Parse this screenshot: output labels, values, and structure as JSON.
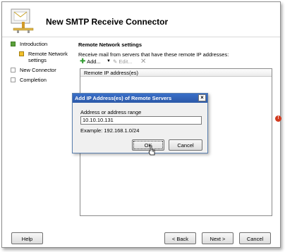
{
  "window": {
    "title": "New SMTP Receive Connector"
  },
  "nav": {
    "items": [
      {
        "label": "Introduction",
        "state": "done"
      },
      {
        "label": "Remote Network settings",
        "state": "current"
      },
      {
        "label": "New Connector",
        "state": "pending"
      },
      {
        "label": "Completion",
        "state": "pending"
      }
    ]
  },
  "main": {
    "section_title": "Remote Network settings",
    "description": "Receive mail from servers that have these remote IP addresses:",
    "toolbar": {
      "add_label": "Add...",
      "edit_label": "Edit...",
      "delete_icon": "delete-icon"
    },
    "list": {
      "column_header": "Remote IP address(es)",
      "rows": []
    }
  },
  "dialog": {
    "title": "Add IP Address(es) of Remote Servers",
    "close_glyph": "×",
    "field_label": "Address or address range",
    "field_value": "10.10.10.131",
    "example": "Example: 192.168.1.0/24",
    "ok_label": "OK",
    "cancel_label": "Cancel"
  },
  "footer": {
    "help_label": "Help",
    "back_label": "< Back",
    "next_label": "Next >",
    "cancel_label": "Cancel"
  },
  "status": {
    "error_glyph": "!"
  },
  "colors": {
    "nav_done": "#5aa03a",
    "nav_current": "#f2c12e",
    "dialog_title": "#2c59a8",
    "error": "#d23a1f"
  }
}
